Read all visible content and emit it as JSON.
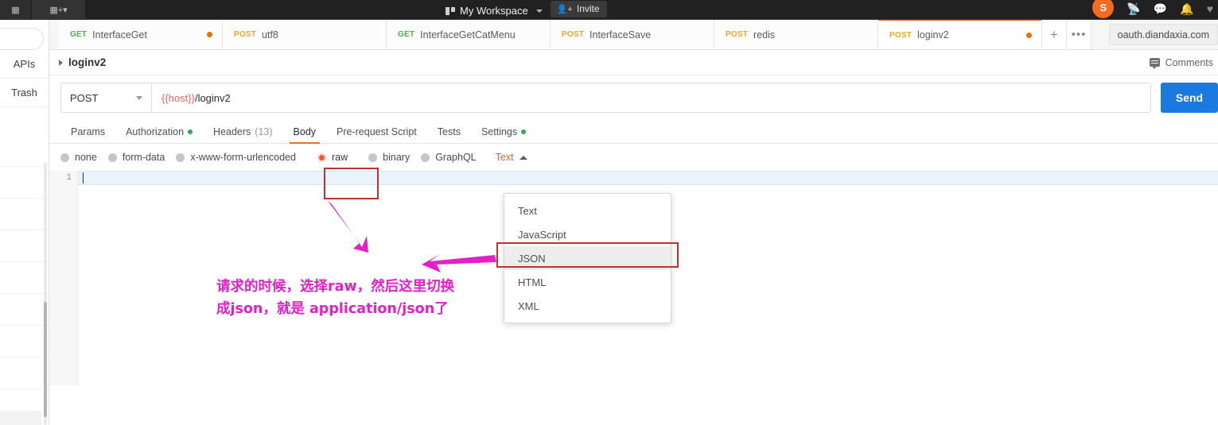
{
  "topbar": {
    "workspace_label": "My Workspace",
    "invite_label": "Invite",
    "avatar_initial": "S",
    "icons": [
      "sync-icon",
      "comment-icon",
      "bell-icon",
      "heart-icon"
    ]
  },
  "sidebar": {
    "items": [
      {
        "label": "APIs"
      },
      {
        "label": "Trash"
      }
    ]
  },
  "tabs": {
    "items": [
      {
        "method": "GET",
        "name": "InterfaceGet",
        "unsaved": true,
        "active": false
      },
      {
        "method": "POST",
        "name": "utf8",
        "unsaved": false,
        "active": false
      },
      {
        "method": "GET",
        "name": "InterfaceGetCatMenu",
        "unsaved": false,
        "active": false
      },
      {
        "method": "POST",
        "name": "InterfaceSave",
        "unsaved": false,
        "active": false
      },
      {
        "method": "POST",
        "name": "redis",
        "unsaved": false,
        "active": false
      },
      {
        "method": "POST",
        "name": "loginv2",
        "unsaved": true,
        "active": true
      }
    ],
    "add_label": "+",
    "more_label": "•••",
    "environment": "oauth.diandaxia.com"
  },
  "breadcrumb": {
    "title": "loginv2",
    "comments_label": "Comments"
  },
  "request": {
    "method": "POST",
    "url_variable": "{{host}}",
    "url_path": "/loginv2",
    "send_label": "Send"
  },
  "request_tabs": [
    {
      "label": "Params",
      "badge": "",
      "dot": false,
      "active": false
    },
    {
      "label": "Authorization",
      "badge": "",
      "dot": true,
      "active": false
    },
    {
      "label": "Headers",
      "badge": "(13)",
      "dot": false,
      "active": false
    },
    {
      "label": "Body",
      "badge": "",
      "dot": false,
      "active": true
    },
    {
      "label": "Pre-request Script",
      "badge": "",
      "dot": false,
      "active": false
    },
    {
      "label": "Tests",
      "badge": "",
      "dot": false,
      "active": false
    },
    {
      "label": "Settings",
      "badge": "",
      "dot": true,
      "active": false
    }
  ],
  "body_types": [
    {
      "label": "none",
      "selected": false
    },
    {
      "label": "form-data",
      "selected": false
    },
    {
      "label": "x-www-form-urlencoded",
      "selected": false
    },
    {
      "label": "raw",
      "selected": true
    },
    {
      "label": "binary",
      "selected": false
    },
    {
      "label": "GraphQL",
      "selected": false
    }
  ],
  "raw_format": {
    "selected": "Text",
    "options": [
      {
        "label": "Text",
        "highlighted": false
      },
      {
        "label": "JavaScript",
        "highlighted": false
      },
      {
        "label": "JSON",
        "highlighted": true
      },
      {
        "label": "HTML",
        "highlighted": false
      },
      {
        "label": "XML",
        "highlighted": false
      }
    ]
  },
  "editor": {
    "line_number": "1",
    "content": ""
  },
  "annotation": {
    "text_line1": "请求的时候，选择raw，然后这里切换",
    "text_line2": "成json，就是 application/json了",
    "color": "#e320c8",
    "highlight_box_color": "#c4302b"
  },
  "colors": {
    "accent_orange": "#ef6c2a",
    "send_blue": "#1a7ae0",
    "get_green": "#4caf50",
    "post_yellow": "#f0a526",
    "avatar_orange": "#f26b21",
    "status_green": "#2bab5a"
  }
}
